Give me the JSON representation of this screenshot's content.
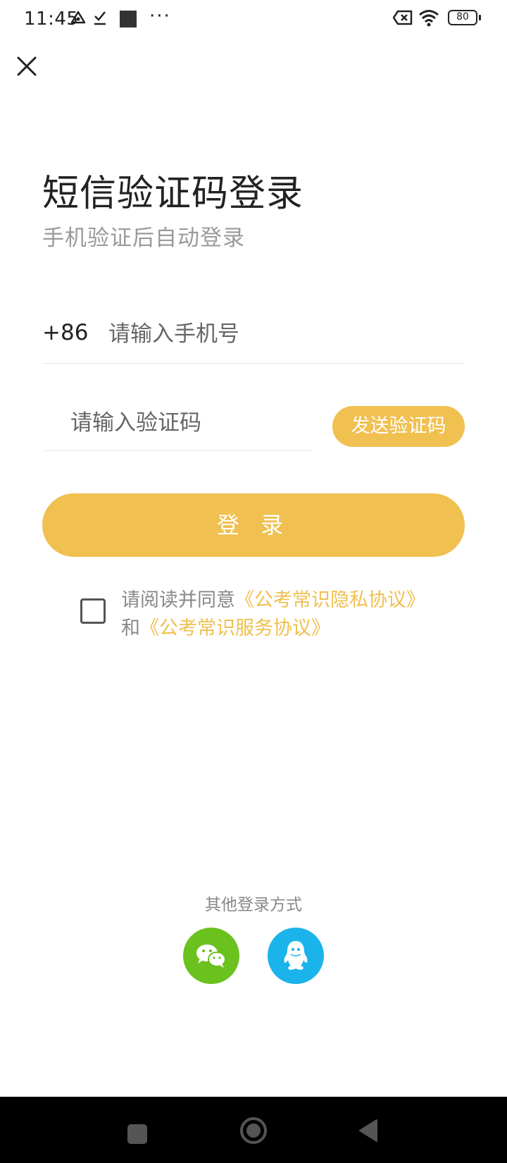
{
  "status_bar": {
    "time": "11:45",
    "dots": "···",
    "battery": "80"
  },
  "header": {
    "title": "短信验证码登录",
    "subtitle": "手机验证后自动登录"
  },
  "form": {
    "country_code": "+86",
    "phone_placeholder": "请输入手机号",
    "code_placeholder": "请输入验证码",
    "send_code_label": "发送验证码",
    "login_label": "登 录"
  },
  "agreement": {
    "prefix": "请阅读并同意",
    "privacy_link": "《公考常识隐私协议》",
    "conjunction": "和",
    "service_link": "《公考常识服务协议》"
  },
  "other_login": {
    "label": "其他登录方式",
    "methods": [
      "wechat-icon",
      "qq-icon"
    ]
  },
  "icons": {
    "close": "close-icon",
    "nav_recent": "square-icon",
    "nav_home": "circle-icon",
    "nav_back": "triangle-back-icon"
  },
  "colors": {
    "accent": "#f0c050",
    "wechat": "#6bc11d",
    "qq": "#1ab4ea",
    "text_primary": "#222222",
    "text_secondary": "#9a9a9a"
  }
}
